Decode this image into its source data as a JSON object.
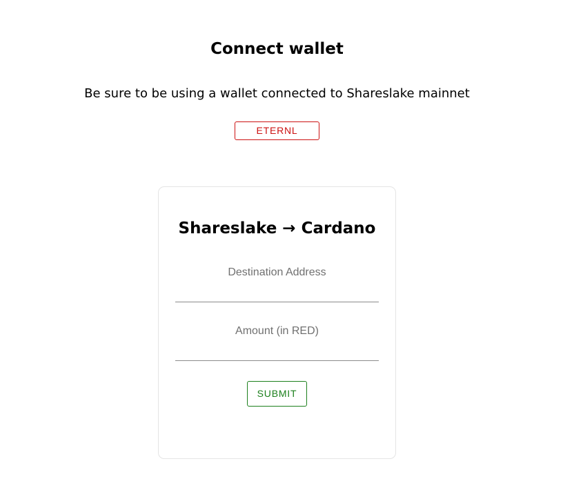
{
  "header": {
    "title": "Connect wallet",
    "subtitle": "Be sure to be using a wallet connected to Shareslake mainnet"
  },
  "wallets": {
    "eternl_label": "ETERNL"
  },
  "bridge_form": {
    "title": "Shareslake → Cardano",
    "destination_label": "Destination Address",
    "destination_value": "",
    "amount_label": "Amount (in RED)",
    "amount_value": "",
    "submit_label": "SUBMIT"
  },
  "colors": {
    "wallet_button": "#cc1111",
    "submit_button": "#1b7f1b",
    "label_text": "#707070"
  }
}
